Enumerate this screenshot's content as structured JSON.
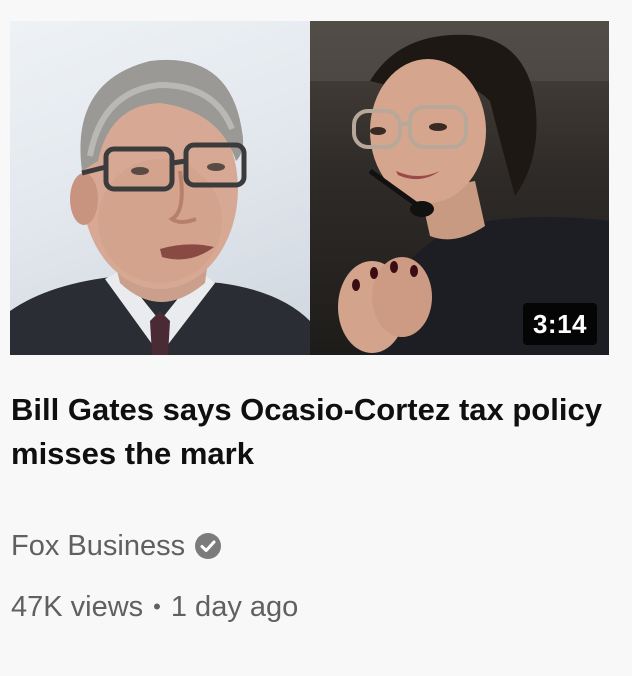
{
  "video": {
    "duration": "3:14",
    "title": "Bill Gates says Ocasio-Cortez tax policy misses the mark",
    "channel": "Fox Business",
    "channel_verified": true,
    "views": "47K views",
    "separator": "•",
    "age": "1 day ago"
  },
  "icons": {
    "verified": "verified-check-icon"
  },
  "colors": {
    "title": "#0f0f0f",
    "meta": "#606060",
    "background": "#f8f8f8",
    "duration_bg": "#000000"
  }
}
